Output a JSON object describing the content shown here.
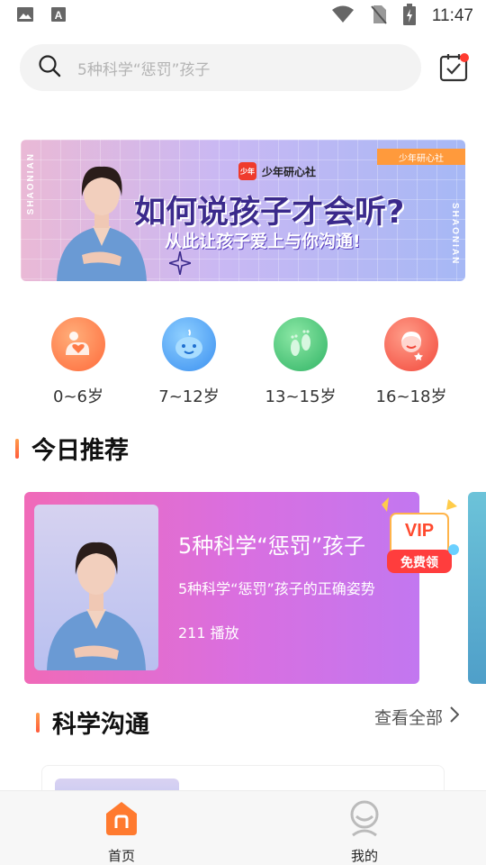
{
  "status_bar": {
    "time": "11:47",
    "icons": [
      "image-icon",
      "text-a-icon",
      "wifi-icon",
      "no-sim-icon",
      "battery-charging-icon"
    ]
  },
  "search": {
    "placeholder": "5种科学“惩罚”孩子",
    "icon": "search-icon",
    "calendar_icon": "calendar-check-icon"
  },
  "banner": {
    "vertical_left": "SHAONIAN",
    "vertical_right": "SHAONIAN",
    "brand_logo": "少年",
    "brand_name": "少年研心社",
    "tag": "少年研心社",
    "title": "如何说孩子才会听?",
    "subtitle": "从此让孩子爱上与你沟通!"
  },
  "age_groups": [
    {
      "label": "0~6岁",
      "icon": "baby-heart-icon",
      "color": "#ff7a45"
    },
    {
      "label": "7~12岁",
      "icon": "child-face-icon",
      "color": "#4aa8f5"
    },
    {
      "label": "13~15岁",
      "icon": "footprints-icon",
      "color": "#4cc77a"
    },
    {
      "label": "16~18岁",
      "icon": "teen-face-icon",
      "color": "#ff6b57"
    }
  ],
  "today": {
    "heading": "今日推荐",
    "card": {
      "title": "5种科学“惩罚”孩子",
      "description": "5种科学“惩罚”孩子的正确姿势",
      "plays": "211 播放",
      "badge_top": "VIP",
      "badge_bottom": "免费领"
    }
  },
  "science": {
    "heading": "科学沟通",
    "view_all": "查看全部"
  },
  "tabbar": {
    "tabs": [
      {
        "label": "首页",
        "icon": "home-icon",
        "active": true
      },
      {
        "label": "我的",
        "icon": "profile-icon",
        "active": false
      }
    ]
  },
  "colors": {
    "accent_orange": "#ff7a2f",
    "card_pink": "#f06ab8",
    "card_purple": "#c277f0"
  }
}
